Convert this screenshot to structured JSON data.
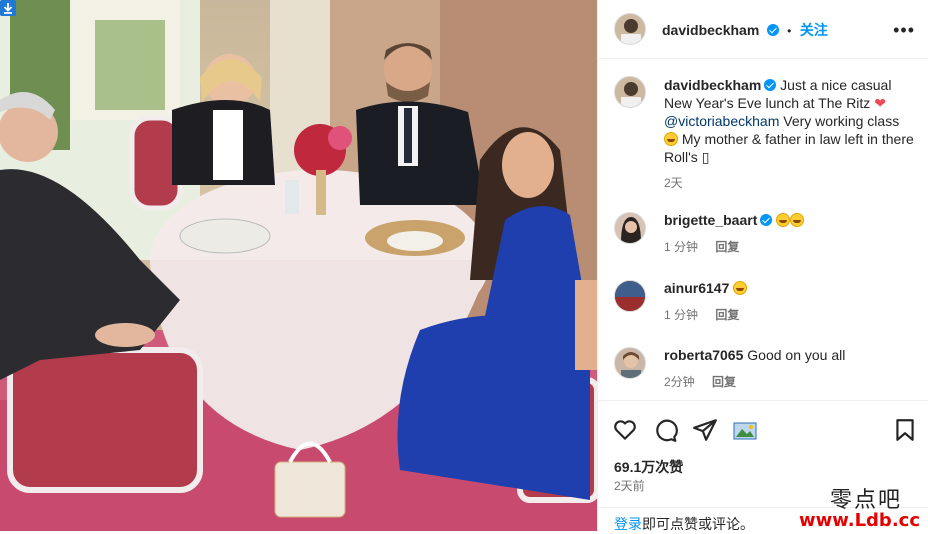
{
  "post": {
    "username": "davidbeckham",
    "follow_label": "关注",
    "dot": "•",
    "more_label": "•••"
  },
  "caption": {
    "username": "davidbeckham",
    "text_part1": "Just a nice casual New Year's Eve lunch at The Ritz",
    "mention": "@victoriabeckham",
    "text_part2": "Very working class",
    "text_part3": "My mother & father in law left in there Roll's",
    "trailing": "▯",
    "time": "2天"
  },
  "comments": [
    {
      "username": "brigette_baart",
      "text": "",
      "time": "1 分钟",
      "reply": "回复"
    },
    {
      "username": "ainur6147",
      "text": "",
      "time": "1 分钟",
      "reply": "回复"
    },
    {
      "username": "roberta7065",
      "text": "Good on you all",
      "time": "2分钟",
      "reply": "回复"
    }
  ],
  "footer": {
    "likes": "69.1万次赞",
    "date": "2天前",
    "login_link": "登录",
    "login_text": "即可点赞或评论。"
  },
  "watermark": {
    "line1": "零点吧",
    "line2": "www.Ldb.cc"
  },
  "colors": {
    "accent": "#0095f6",
    "heart": "#ed4956",
    "dress": "#1f3fae"
  }
}
